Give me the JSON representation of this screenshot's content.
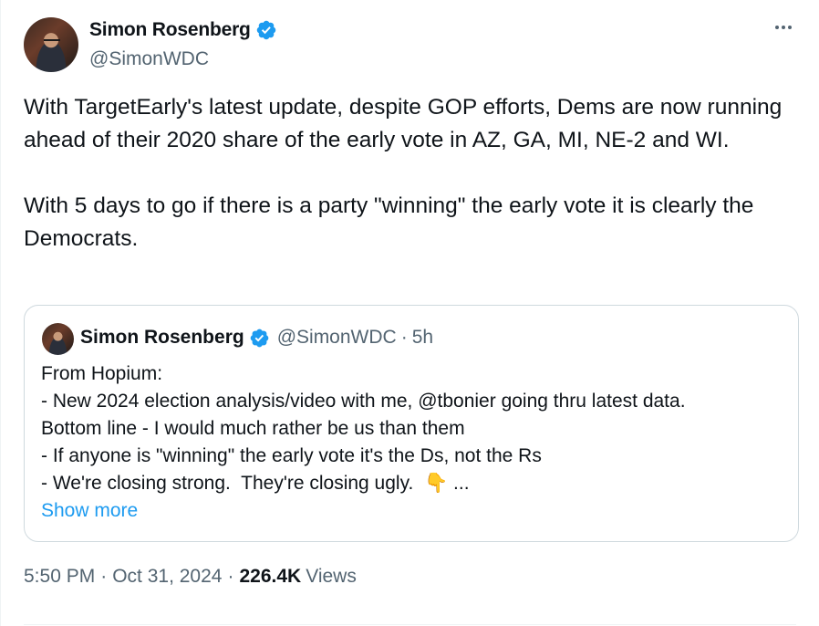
{
  "tweet": {
    "author_name": "Simon Rosenberg",
    "author_handle": "@SimonWDC",
    "body_para1": "With TargetEarly's latest update, despite GOP efforts, Dems are now running ahead of their 2020 share of the early vote in AZ, GA, MI, NE-2 and WI.",
    "body_para2": "With 5 days to go if there is a party \"winning\" the early vote it is clearly the Democrats.",
    "time": "5:50 PM",
    "date": "Oct 31, 2024",
    "views_count": "226.4K",
    "views_label": "Views",
    "separator": "·"
  },
  "quote": {
    "author_name": "Simon Rosenberg",
    "author_handle": "@SimonWDC",
    "separator": "·",
    "time_ago": "5h",
    "lines": [
      "From Hopium:",
      "- New 2024 election analysis/video with me, @tbonier going thru latest data.",
      "Bottom line - I would much rather be us than them",
      "- If anyone is \"winning\" the early vote it's the Ds, not the Rs",
      "- We're closing strong.  They're closing ugly."
    ],
    "last_line_emoji": "👇",
    "ellipsis": "...",
    "show_more": "Show more"
  },
  "colors": {
    "verified": "#1d9bf0",
    "link": "#1d9bf0",
    "secondary_text": "#536471",
    "primary_text": "#0f1419"
  },
  "icons": {
    "verified": "verified-badge-icon",
    "more": "more-options-icon"
  }
}
